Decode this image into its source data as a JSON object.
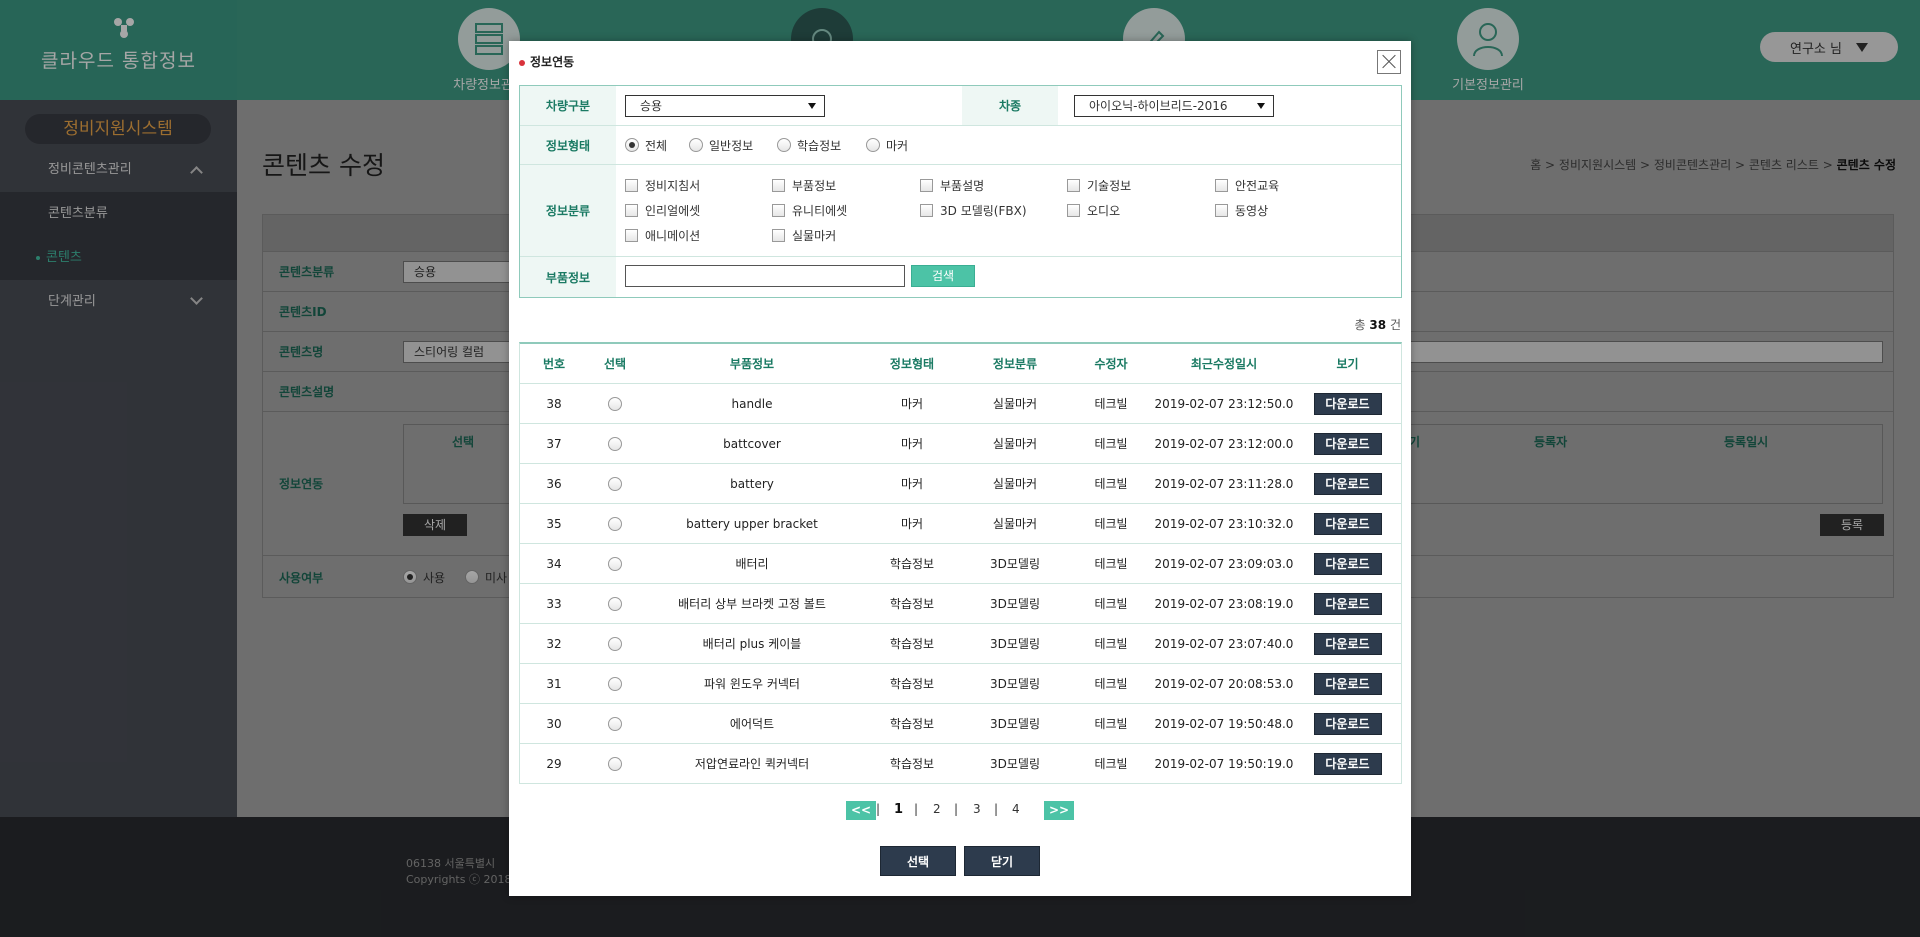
{
  "app": {
    "title": "클라우드 통합정보"
  },
  "topnav": [
    {
      "label": "차량정보관리"
    },
    {
      "label": ""
    },
    {
      "label": ""
    },
    {
      "label": "기본정보관리"
    }
  ],
  "user": {
    "label": "연구소 님"
  },
  "sidebar": {
    "system": "정비지원시스템",
    "items": [
      {
        "label": "정비콘텐츠관리"
      },
      {
        "label": "콘텐츠분류"
      },
      {
        "label": "콘텐츠"
      },
      {
        "label": "단계관리"
      }
    ]
  },
  "page": {
    "title": "콘텐츠 수정",
    "breadcrumb": [
      "홈",
      "정비지원시스템",
      "정비콘텐츠관리",
      "콘텐츠 리스트",
      "콘텐츠 수정"
    ]
  },
  "form": {
    "labels": {
      "category": "콘텐츠분류",
      "id": "콘텐츠ID",
      "name": "콘텐츠명",
      "desc": "콘텐츠설명",
      "link": "정보연동",
      "use": "사용여부"
    },
    "category_value": "승용",
    "name_value": "스티어링 컬럼",
    "link_headers": {
      "select": "선택",
      "date": "기",
      "registrant": "등록자",
      "regdate": "등록일시"
    },
    "delete_label": "삭제",
    "register_label": "등록",
    "use_options": [
      "사용",
      "미사"
    ]
  },
  "footer": {
    "line1": "06138 서울특별시 ",
    "line2": "Copyrights ⓒ 2018"
  },
  "modal": {
    "title": "정보연동",
    "filters": {
      "vehicle_type_label": "차량구분",
      "vehicle_type_value": "승용",
      "model_label": "차종",
      "model_value": "아이오닉-하이브리드-2016",
      "info_form_label": "정보형태",
      "info_form_options": [
        "전체",
        "일반정보",
        "학습정보",
        "마커"
      ],
      "info_class_label": "정보분류",
      "info_class_options": [
        "정비지침서",
        "부품정보",
        "부품설명",
        "기술정보",
        "안전교육",
        "인리얼에셋",
        "유니티에셋",
        "3D 모델링(FBX)",
        "오디오",
        "동영상",
        "애니메이션",
        "실물마커"
      ],
      "part_label": "부품정보",
      "part_value": "",
      "search_label": "검색"
    },
    "total": {
      "prefix": "총",
      "count": "38",
      "suffix": "건"
    },
    "table": {
      "headers": [
        "번호",
        "선택",
        "부품정보",
        "정보형태",
        "정보분류",
        "수정자",
        "최근수정일시",
        "보기"
      ],
      "rows": [
        {
          "no": "38",
          "part": "handle",
          "form": "마커",
          "class": "실물마커",
          "editor": "테크빌",
          "date": "2019-02-07 23:12:50.0",
          "view": "다운로드"
        },
        {
          "no": "37",
          "part": "battcover",
          "form": "마커",
          "class": "실물마커",
          "editor": "테크빌",
          "date": "2019-02-07 23:12:00.0",
          "view": "다운로드"
        },
        {
          "no": "36",
          "part": "battery",
          "form": "마커",
          "class": "실물마커",
          "editor": "테크빌",
          "date": "2019-02-07 23:11:28.0",
          "view": "다운로드"
        },
        {
          "no": "35",
          "part": "battery upper bracket",
          "form": "마커",
          "class": "실물마커",
          "editor": "테크빌",
          "date": "2019-02-07 23:10:32.0",
          "view": "다운로드"
        },
        {
          "no": "34",
          "part": "배터리",
          "form": "학습정보",
          "class": "3D모델링",
          "editor": "테크빌",
          "date": "2019-02-07 23:09:03.0",
          "view": "다운로드"
        },
        {
          "no": "33",
          "part": "배터리 상부 브라켓 고정 볼트",
          "form": "학습정보",
          "class": "3D모델링",
          "editor": "테크빌",
          "date": "2019-02-07 23:08:19.0",
          "view": "다운로드"
        },
        {
          "no": "32",
          "part": "배터리 plus 케이블",
          "form": "학습정보",
          "class": "3D모델링",
          "editor": "테크빌",
          "date": "2019-02-07 23:07:40.0",
          "view": "다운로드"
        },
        {
          "no": "31",
          "part": "파워 윈도우 커넥터",
          "form": "학습정보",
          "class": "3D모델링",
          "editor": "테크빌",
          "date": "2019-02-07 20:08:53.0",
          "view": "다운로드"
        },
        {
          "no": "30",
          "part": "에어덕트",
          "form": "학습정보",
          "class": "3D모델링",
          "editor": "테크빌",
          "date": "2019-02-07 19:50:48.0",
          "view": "다운로드"
        },
        {
          "no": "29",
          "part": "저압연료라인 퀵커넥터",
          "form": "학습정보",
          "class": "3D모델링",
          "editor": "테크빌",
          "date": "2019-02-07 19:50:19.0",
          "view": "다운로드"
        }
      ]
    },
    "pager": {
      "prev": "<<",
      "next": ">>",
      "pages": [
        "1",
        "2",
        "3",
        "4"
      ],
      "current": "1"
    },
    "buttons": {
      "select": "선택",
      "close": "닫기"
    }
  },
  "colors": {
    "brand": "#3f9d86",
    "accent": "#4cc3a6",
    "dark_button": "#2d3b4d",
    "sidebar": "#4b4f57"
  }
}
